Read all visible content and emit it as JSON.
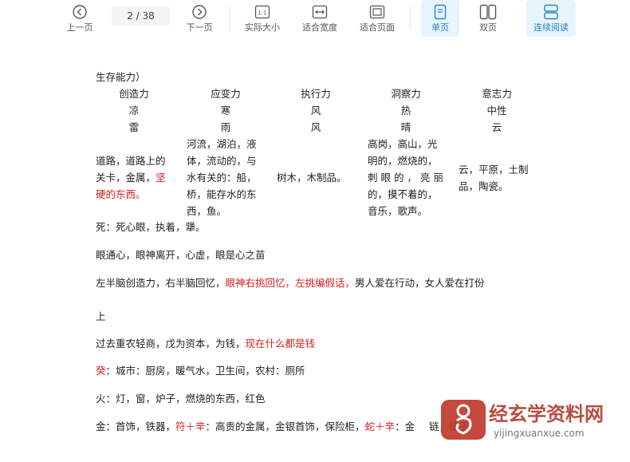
{
  "toolbar": {
    "prev_label": "上一页",
    "page_indicator": "2  /  38",
    "next_label": "下一页",
    "actual_size_label": "实际大小",
    "fit_width_label": "适合宽度",
    "fit_page_label": "适合页面",
    "single_page_label": "单页",
    "double_page_label": "双页",
    "continuous_label": "连续阅读",
    "actual_size_glyph": "1:1"
  },
  "doc": {
    "heading": "生存能力）",
    "columns": [
      {
        "name": "创造力",
        "r1": "凉",
        "r2": "雷"
      },
      {
        "name": "应变力",
        "r1": "寒",
        "r2": "雨"
      },
      {
        "name": "执行力",
        "r1": "风",
        "r2": "风"
      },
      {
        "name": "洞察力",
        "r1": "热",
        "r2": "晴"
      },
      {
        "name": "意志力",
        "r1": "中性",
        "r2": "云"
      }
    ],
    "cell1": [
      "道路，道路上的",
      "关卡，金属，",
      "坚",
      "硬的东西。"
    ],
    "cell2": [
      "河流，湖泊，液",
      "体，流动的，与",
      "水有关的：船，",
      "桥，能存水的东",
      "西，鱼。"
    ],
    "cell3": "树木，木制品。",
    "cell4": [
      "高岗，高山，光",
      "明的，燃烧的，",
      "刺 眼 的 ， 亮 丽",
      "的，摸不着的，",
      "音乐，歌声。"
    ],
    "cell5": [
      "云，平原，土制",
      "品，陶瓷。"
    ],
    "line_death": "死：死心眼，执着，犟。",
    "line_eyes": "眼通心，眼神离开，心虚，眼是心之苗",
    "line_brain_a": "左半脑创造力，右半脑回忆，",
    "line_brain_b": "眼神右挑回忆，左挑编假话，",
    "line_brain_c": "男人爱在行动，女人爱在打份",
    "line_up": "上",
    "line_past_a": "过去重农轻商，戊为资本，为钱，",
    "line_past_b": "现在什么都是钱",
    "line_gui_a": "癸",
    "line_gui_b": "：城市：厨房，暖气水，卫生间，农村：厕所",
    "line_fire": "火：灯，窗，炉子，燃烧的东西，红色",
    "line_metal_a": "金：首饰，铁器，",
    "line_metal_b": "符＋辛",
    "line_metal_c": "：高贵的金属，金银首饰，保险柜，",
    "line_metal_d": "蛇＋辛",
    "line_metal_e": "：金",
    "line_metal_f": "链，链子",
    "watermark_cn": "经玄学资料网",
    "watermark_url": "yijingxuanxue.com"
  },
  "colors": {
    "accent": "#2a84c6",
    "red": "#d42020",
    "active_bg": "#e8f4fb"
  }
}
